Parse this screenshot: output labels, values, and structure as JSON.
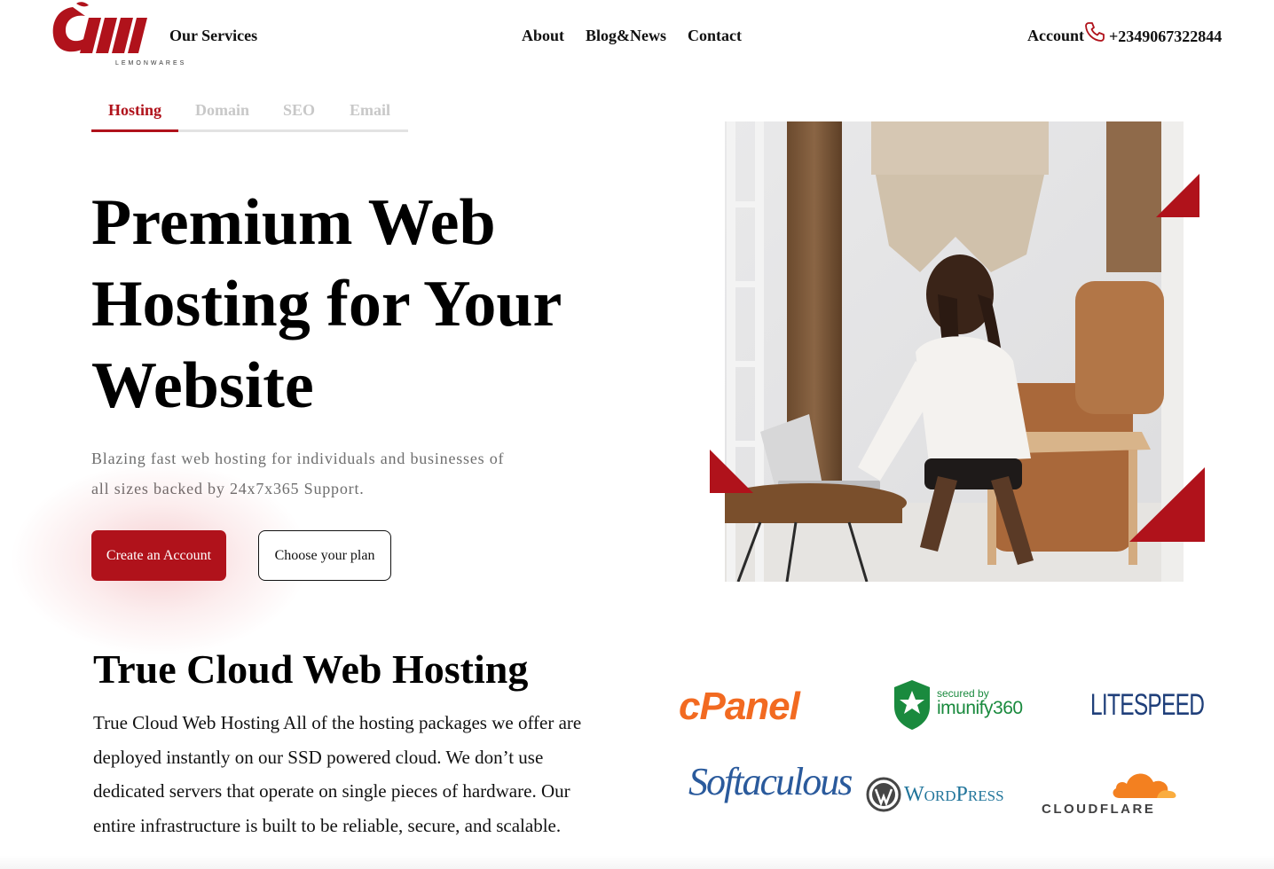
{
  "brand": {
    "wordmark": "LEMONWARES",
    "color": "#b0121b"
  },
  "nav": {
    "our_services": "Our Services",
    "about": "About",
    "blog": "Blog&News",
    "contact": "Contact",
    "account": "Account",
    "phone": "+2349067322844"
  },
  "tabs": [
    {
      "label": "Hosting",
      "active": true
    },
    {
      "label": "Domain",
      "active": false
    },
    {
      "label": "SEO",
      "active": false
    },
    {
      "label": "Email",
      "active": false
    }
  ],
  "hero": {
    "title_lines": [
      "Premium Web",
      "Hosting for Your",
      "Website"
    ],
    "subtitle": "Blazing fast web hosting for individuals and businesses of all sizes backed by 24x7x365 Support.",
    "primary_cta": "Create an Account",
    "secondary_cta": "Choose your plan"
  },
  "section": {
    "title": "True Cloud Web Hosting",
    "body": "True Cloud Web Hosting All of the hosting packages we offer are deployed instantly on our SSD powered cloud. We don’t use dedicated servers that operate on single pieces of hardware. Our entire infrastructure is built to be reliable, secure, and scalable."
  },
  "partners": {
    "cpanel": "cPanel",
    "imunify_top": "secured by",
    "imunify_bottom": "imunify360",
    "litespeed": "LITESPEED",
    "softaculous": "Softaculous",
    "wordpress": "WordPress",
    "cloudflare": "CLOUDFLARE"
  }
}
